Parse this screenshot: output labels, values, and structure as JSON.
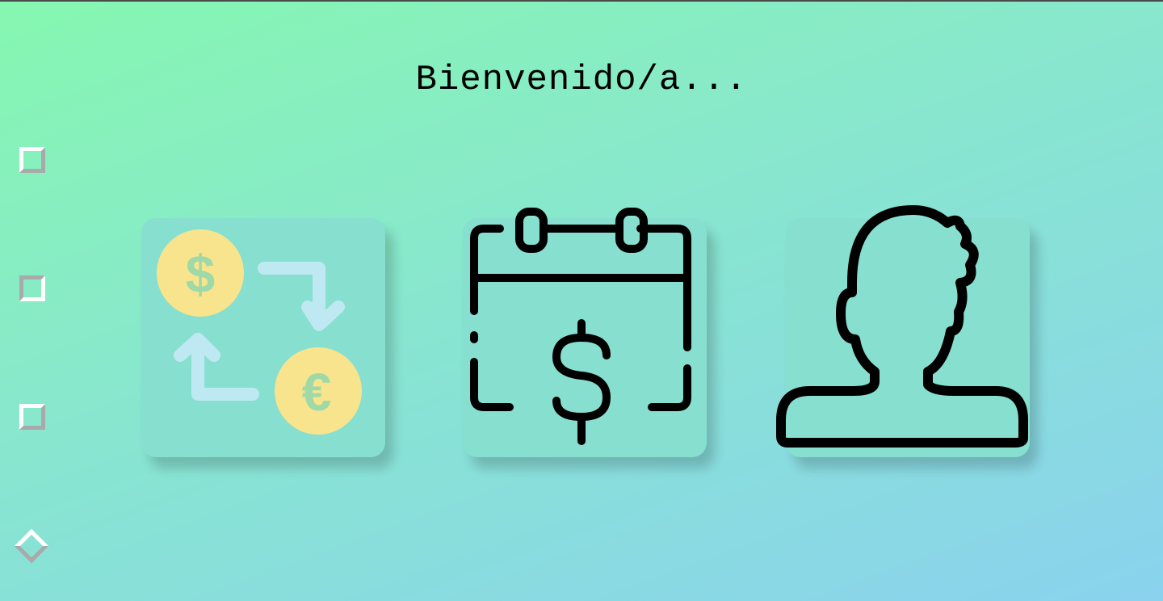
{
  "page": {
    "title": "Bienvenido/a..."
  },
  "colors": {
    "background_start": "#86f7b0",
    "background_end": "#8ad2ee",
    "card_bg": "#87dfd0",
    "coin_yellow": "#f8e48c",
    "coin_symbol": "#9fd9a8",
    "arrow_blue": "#bfe9f2",
    "icon_stroke": "#000000"
  },
  "sidebar": {
    "buttons": [
      {
        "icon": "square-outline-icon"
      },
      {
        "icon": "square-outline-icon"
      },
      {
        "icon": "square-outline-icon"
      },
      {
        "icon": "diamond-outline-icon"
      }
    ]
  },
  "cards": [
    {
      "icon": "currency-exchange-icon",
      "coin1_symbol": "$",
      "coin2_symbol": "€"
    },
    {
      "icon": "calendar-dollar-icon",
      "symbol": "$"
    },
    {
      "icon": "user-profile-icon"
    }
  ]
}
